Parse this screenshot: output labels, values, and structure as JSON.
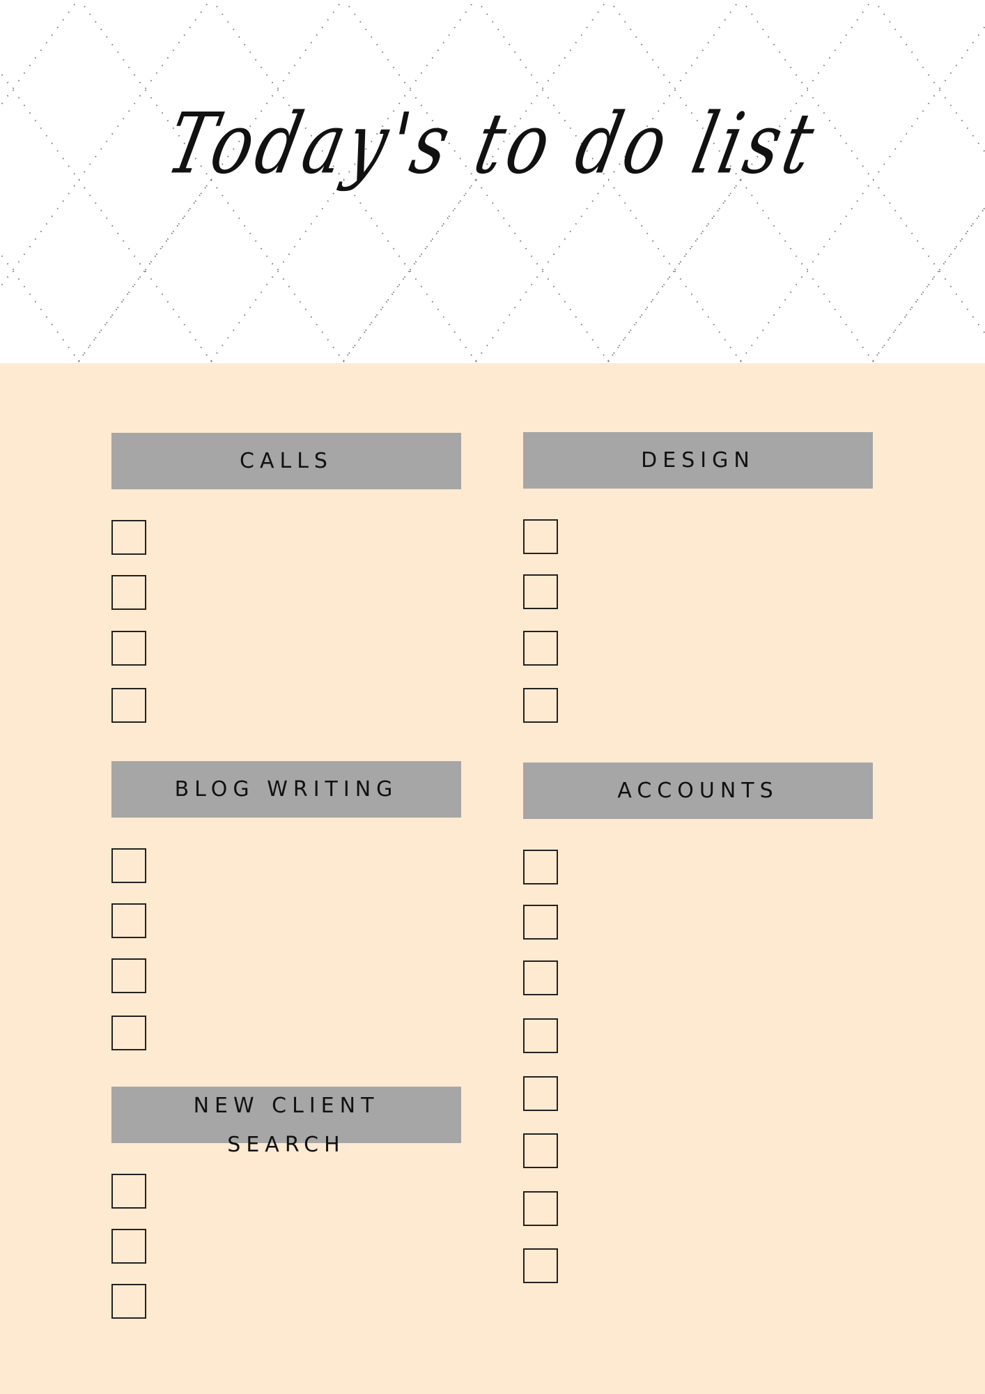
{
  "title": "Today's to do list",
  "colors": {
    "header_bg": "#ffffff",
    "body_bg": "#fdead1",
    "section_header_bg": "#a6a6a6",
    "text": "#111111",
    "checkbox_border": "#222222",
    "dot_pattern": "#555555"
  },
  "sections": [
    {
      "id": "calls",
      "label": "CALLS",
      "checkbox_count": 4,
      "checked": [
        false,
        false,
        false,
        false
      ]
    },
    {
      "id": "design",
      "label": "DESIGN",
      "checkbox_count": 4,
      "checked": [
        false,
        false,
        false,
        false
      ]
    },
    {
      "id": "blog-writing",
      "label": "BLOG WRITING",
      "checkbox_count": 4,
      "checked": [
        false,
        false,
        false,
        false
      ]
    },
    {
      "id": "accounts",
      "label": "ACCOUNTS",
      "checkbox_count": 8,
      "checked": [
        false,
        false,
        false,
        false,
        false,
        false,
        false,
        false
      ]
    },
    {
      "id": "new-client-search",
      "label": "NEW CLIENT SEARCH",
      "checkbox_count": 3,
      "checked": [
        false,
        false,
        false
      ]
    }
  ]
}
